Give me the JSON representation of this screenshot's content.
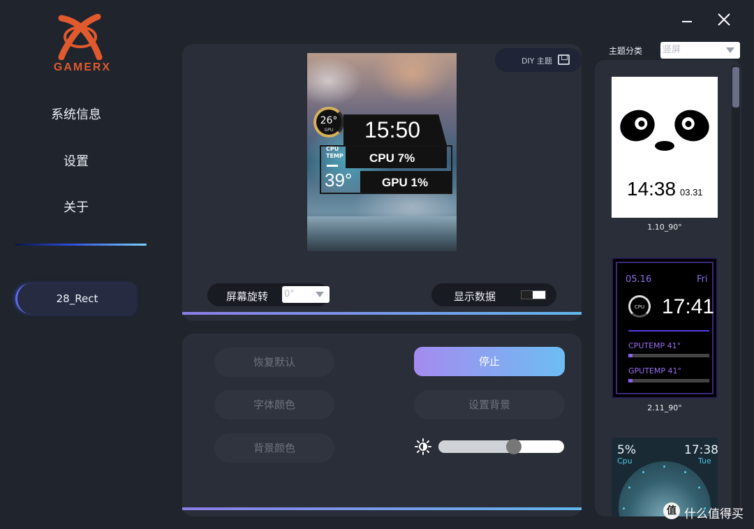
{
  "brand": {
    "logo_text": "GAMERX"
  },
  "sidebar": {
    "items": [
      {
        "label": "系统信息"
      },
      {
        "label": "设置"
      },
      {
        "label": "关于"
      }
    ],
    "device_label": "28_Rect"
  },
  "preview": {
    "diy_label": "DIY 主题",
    "gauge_value": "26°",
    "gauge_label": "GPU",
    "clock": "15:50",
    "temp_label_1": "CPU",
    "temp_label_2": "TEMP",
    "temp_value": "39°",
    "cpu_text": "CPU  7%",
    "gpu_text": "GPU  1%",
    "rotation_label": "屏幕旋转",
    "rotation_value": "0°",
    "show_data_label": "显示数据"
  },
  "controls": {
    "restore_default": "恢复默认",
    "stop": "停止",
    "font_color": "字体颜色",
    "set_background": "设置背景",
    "bg_color": "背景颜色",
    "brightness": 0.6
  },
  "themes": {
    "category_label": "主题分类",
    "category_value": "竖屏",
    "cards": [
      {
        "time": "14:38",
        "date": "03.31",
        "name": "1.10_90°"
      },
      {
        "date": "05.16",
        "day": "Fri",
        "cpu": "CPU",
        "time": "17:41",
        "label1": "CPUTEMP  41°",
        "label2": "GPUTEMP  41°",
        "name": "2.11_90°"
      },
      {
        "pct": "5%",
        "cpu": "Cpu",
        "time": "17:38",
        "day": "Tue"
      }
    ]
  },
  "watermark": {
    "icon": "值",
    "text": "什么值得买"
  },
  "colors": {
    "accent_start": "#a48bef",
    "accent_end": "#6dbdf3",
    "logo": "#e05a2d"
  }
}
